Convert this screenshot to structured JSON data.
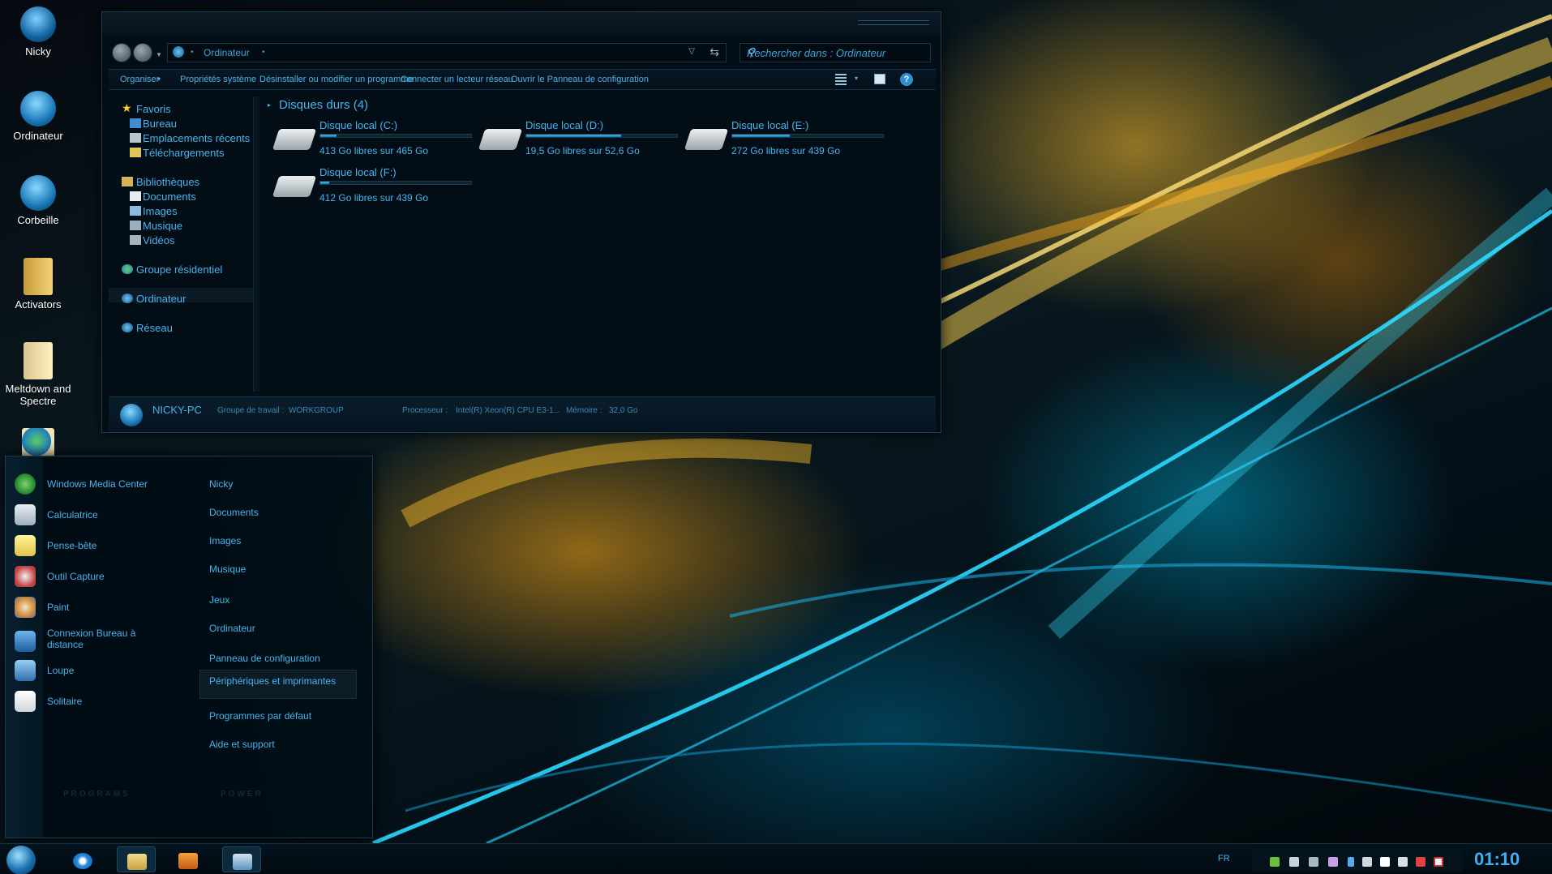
{
  "desktop": {
    "icons": [
      {
        "label": "Nicky",
        "icon": "user-icon"
      },
      {
        "label": "Ordinateur",
        "icon": "computer-icon"
      },
      {
        "label": "Corbeille",
        "icon": "recycle-bin-icon"
      },
      {
        "label": "Activators",
        "icon": "folder-icon"
      },
      {
        "label": "Meltdown and Spectre",
        "icon": "folder-icon"
      },
      {
        "label": "",
        "icon": "globe-icon"
      }
    ]
  },
  "explorer": {
    "breadcrumb": "Ordinateur",
    "search_placeholder": "Rechercher dans : Ordinateur",
    "commands": [
      "Organiser",
      "Propriétés système",
      "Désinstaller ou modifier un programme",
      "Connecter un lecteur réseau",
      "Ouvrir le Panneau de configuration"
    ],
    "nav": {
      "favorites": "Favoris",
      "bureau": "Bureau",
      "emplacements": "Emplacements récents",
      "telechargements": "Téléchargements",
      "bibliotheques": "Bibliothèques",
      "documents": "Documents",
      "images": "Images",
      "musique": "Musique",
      "videos": "Vidéos",
      "groupe": "Groupe résidentiel",
      "ordinateur": "Ordinateur",
      "reseau": "Réseau"
    },
    "group_title": "Disques durs (4)",
    "drives": [
      {
        "name": "Disque local (C:)",
        "free": "413 Go libres sur 465 Go",
        "used_fraction": 0.11
      },
      {
        "name": "Disque local (D:)",
        "free": "19,5 Go libres sur 52,6 Go",
        "used_fraction": 0.63
      },
      {
        "name": "Disque local (E:)",
        "free": "272 Go libres sur 439 Go",
        "used_fraction": 0.38
      },
      {
        "name": "Disque local (F:)",
        "free": "412 Go libres sur 439 Go",
        "used_fraction": 0.06
      }
    ],
    "details": {
      "pc_name": "NICKY-PC",
      "workgroup_label": "Groupe de travail :",
      "workgroup": "WORKGROUP",
      "cpu_label": "Processeur :",
      "cpu": "Intel(R) Xeon(R) CPU E3-1...",
      "mem_label": "Mémoire :",
      "mem": "32,0 Go"
    }
  },
  "startmenu": {
    "programs": [
      "Windows Media Center",
      "Calculatrice",
      "Pense-bête",
      "Outil Capture",
      "Paint",
      "Connexion Bureau à distance",
      "Loupe",
      "Solitaire"
    ],
    "right": [
      "Nicky",
      "Documents",
      "Images",
      "Musique",
      "Jeux",
      "Ordinateur",
      "Panneau de configuration",
      "Périphériques et imprimantes",
      "Programmes par défaut",
      "Aide et support"
    ],
    "faint_programs": "PROGRAMS",
    "faint_power": "POWER"
  },
  "taskbar": {
    "lang": "FR",
    "clock": "01:10"
  },
  "colors": {
    "accent": "#48b4ec",
    "clock": "#3fb1ee",
    "border": "#1d3c52"
  }
}
